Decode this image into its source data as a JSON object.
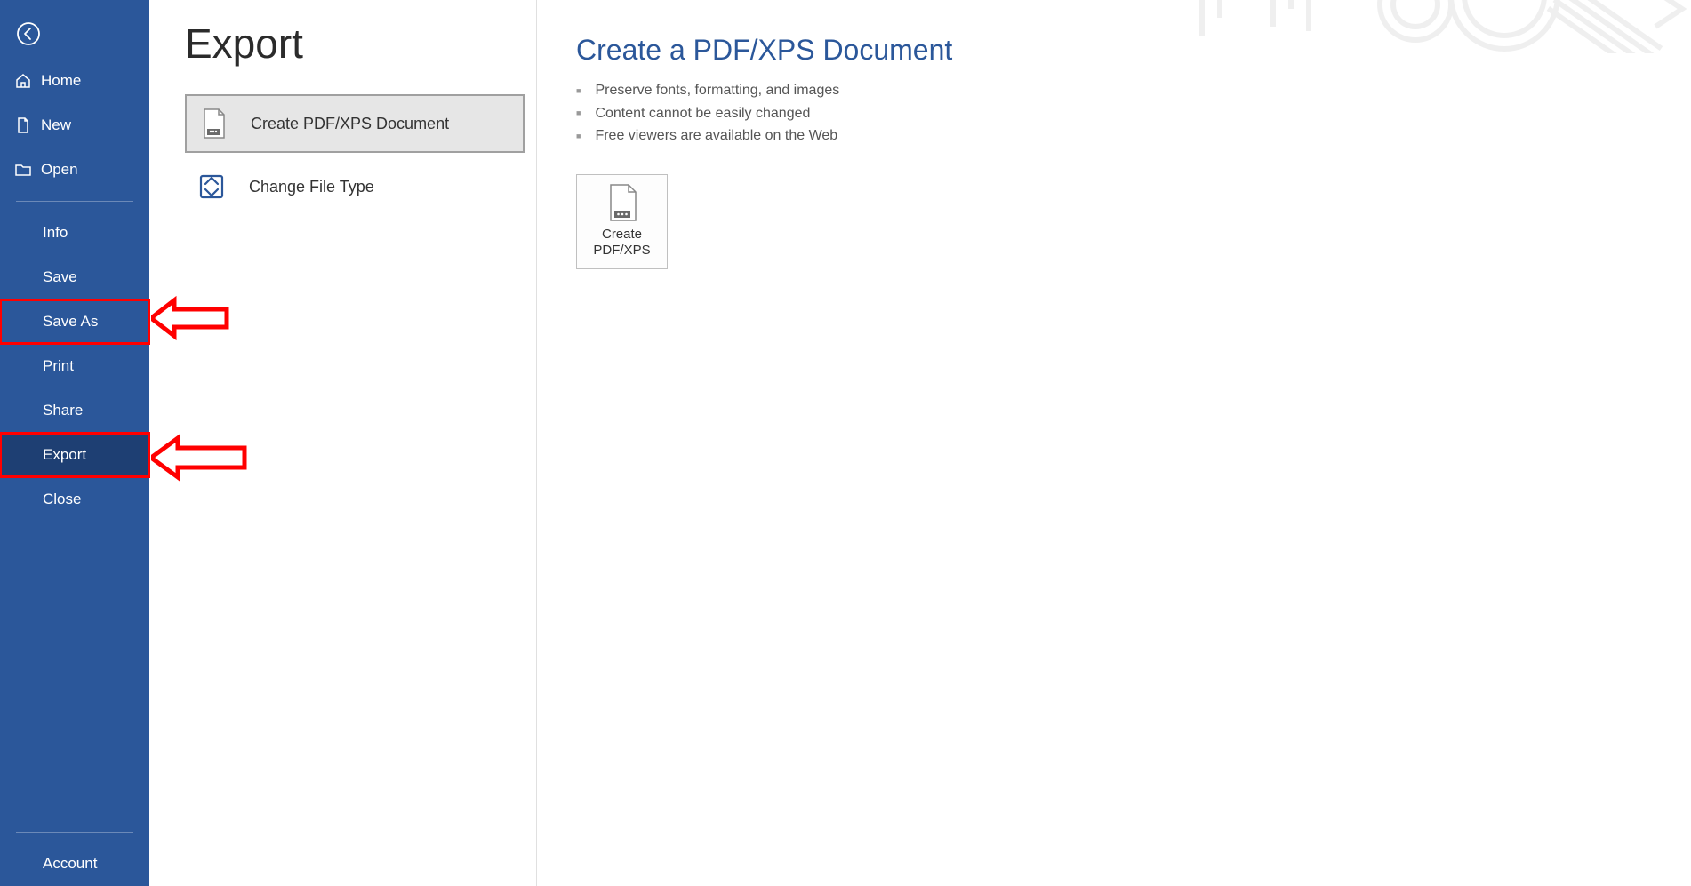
{
  "page_title": "Export",
  "sidebar": {
    "top_items": [
      {
        "label": "Home",
        "icon": "home"
      },
      {
        "label": "New",
        "icon": "new"
      },
      {
        "label": "Open",
        "icon": "open"
      }
    ],
    "mid_items": [
      {
        "label": "Info"
      },
      {
        "label": "Save"
      },
      {
        "label": "Save As",
        "highlighted": true
      },
      {
        "label": "Print"
      },
      {
        "label": "Share"
      },
      {
        "label": "Export",
        "active": true,
        "highlighted": true
      },
      {
        "label": "Close"
      }
    ],
    "bottom_items": [
      {
        "label": "Account"
      }
    ]
  },
  "export_options": [
    {
      "label": "Create PDF/XPS Document",
      "icon": "pdf-doc",
      "selected": true
    },
    {
      "label": "Change File Type",
      "icon": "file-type"
    }
  ],
  "content": {
    "heading": "Create a PDF/XPS Document",
    "bullets": [
      "Preserve fonts, formatting, and images",
      "Content cannot be easily changed",
      "Free viewers are available on the Web"
    ],
    "button_line1": "Create",
    "button_line2": "PDF/XPS"
  }
}
